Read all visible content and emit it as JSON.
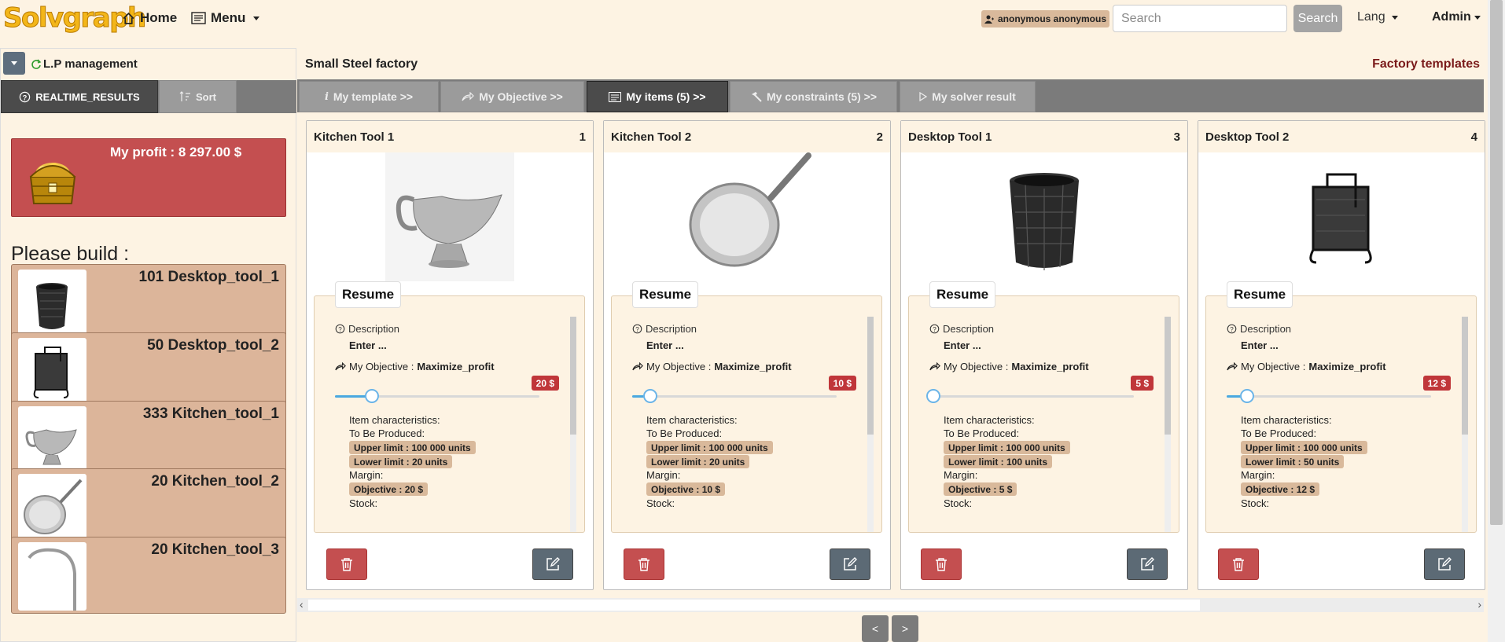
{
  "brand": "Solvgraph",
  "nav": {
    "home": "Home",
    "menu": "Menu",
    "user": "anonymous anonymous",
    "search_placeholder": "Search",
    "search_button": "Search",
    "lang": "Lang",
    "admin": "Admin"
  },
  "left_panel": {
    "title": "L.P management",
    "tabs": {
      "realtime": "REALTIME_RESULTS",
      "sort": "Sort"
    },
    "profit": "My profit : 8 297.00 $",
    "please_build": "Please build :",
    "builds": [
      {
        "label": "101 Desktop_tool_1"
      },
      {
        "label": "50 Desktop_tool_2"
      },
      {
        "label": "333 Kitchen_tool_1"
      },
      {
        "label": "20 Kitchen_tool_2"
      },
      {
        "label": "20 Kitchen_tool_3"
      }
    ]
  },
  "main": {
    "factory_title": "Small Steel factory",
    "factory_templates": "Factory templates",
    "tabs": [
      {
        "label": "My template >>",
        "icon": "info-icon"
      },
      {
        "label": "My Objective >>",
        "icon": "share-icon"
      },
      {
        "label": "My items (5) >>",
        "icon": "list-icon"
      },
      {
        "label": "My constraints (5) >>",
        "icon": "hammer-icon"
      },
      {
        "label": "My solver result",
        "icon": "play-icon"
      }
    ],
    "pager": {
      "prev": "<",
      "next": ">"
    }
  },
  "common": {
    "resume": "Resume",
    "description": "Description",
    "enter": "Enter ...",
    "objective_prefix": "My Objective :",
    "objective_value": "Maximize_profit",
    "item_characteristics": "Item characteristics:",
    "to_be_produced": "To Be Produced:",
    "margin": "Margin:",
    "stock": "Stock:"
  },
  "items": [
    {
      "title": "Kitchen Tool 1",
      "num": "1",
      "price": "20 $",
      "slider_fraction": 0.18,
      "upper": "Upper limit : 100 000 units",
      "lower": "Lower limit : 20 units",
      "objective": "Objective : 20 $"
    },
    {
      "title": "Kitchen Tool 2",
      "num": "2",
      "price": "10 $",
      "slider_fraction": 0.09,
      "upper": "Upper limit : 100 000 units",
      "lower": "Lower limit : 20 units",
      "objective": "Objective : 10 $"
    },
    {
      "title": "Desktop Tool 1",
      "num": "3",
      "price": "5 $",
      "slider_fraction": 0.02,
      "upper": "Upper limit : 100 000 units",
      "lower": "Lower limit : 100 units",
      "objective": "Objective : 5 $"
    },
    {
      "title": "Desktop Tool 2",
      "num": "4",
      "price": "12 $",
      "slider_fraction": 0.1,
      "upper": "Upper limit : 100 000 units",
      "lower": "Lower limit : 50 units",
      "objective": "Objective : 12 $"
    }
  ]
}
